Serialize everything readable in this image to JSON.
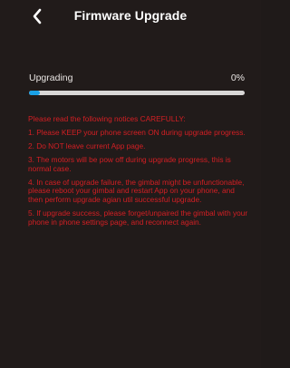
{
  "header": {
    "title": "Firmware Upgrade",
    "back_icon": "chevron-left-icon"
  },
  "progress": {
    "label": "Upgrading",
    "percent_text": "0%",
    "bar_fraction": 0.05,
    "bar_color": "#19a0e6",
    "track_color": "#d9d7d6"
  },
  "notices": {
    "heading": "Please read the following notices CAREFULLY:",
    "items": [
      "1. Please KEEP your phone screen ON during upgrade progress.",
      "2. Do NOT leave current App page.",
      "3. The motors will be pow off during upgrade progress, this is normal case.",
      "4. In case of upgrade failure, the gimbal might be unfunctionable,  please reboot your gimbal and restart App on your phone, and then perform upgrade agian util successful upgrade.",
      "5. If upgrade success, please forget/unpaired the gimbal with your phone in phone settings page, and reconnect again."
    ],
    "color": "#d41f24"
  },
  "colors": {
    "background": "#211b1a",
    "text": "#ffffff"
  }
}
